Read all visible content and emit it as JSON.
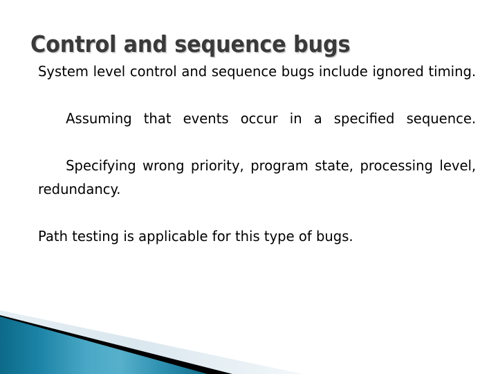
{
  "slide": {
    "title": "Control and sequence bugs",
    "paragraphs": [
      {
        "id": "p1",
        "text": "System level control and sequence bugs include ignored timing.",
        "indented": false
      },
      {
        "id": "p2",
        "text": "Assuming that events occur in a specified sequence.",
        "indented": true
      },
      {
        "id": "p3",
        "text": "Specifying wrong priority, program state, processing level, redundancy.",
        "indented": true
      },
      {
        "id": "p4",
        "text": "Path testing is applicable for this type of bugs.",
        "indented": false
      }
    ]
  },
  "theme": {
    "background": "#ffffff",
    "title_color": "#3a3a3a",
    "title_shadow_color": "#bebebe",
    "body_color": "#000000",
    "accent_teal_dark": "#12718f",
    "accent_teal_mid": "#4aa6c4",
    "accent_teal_light": "#5cb3cc",
    "accent_black": "#000000",
    "accent_pale_blue": "#dce8ee"
  }
}
